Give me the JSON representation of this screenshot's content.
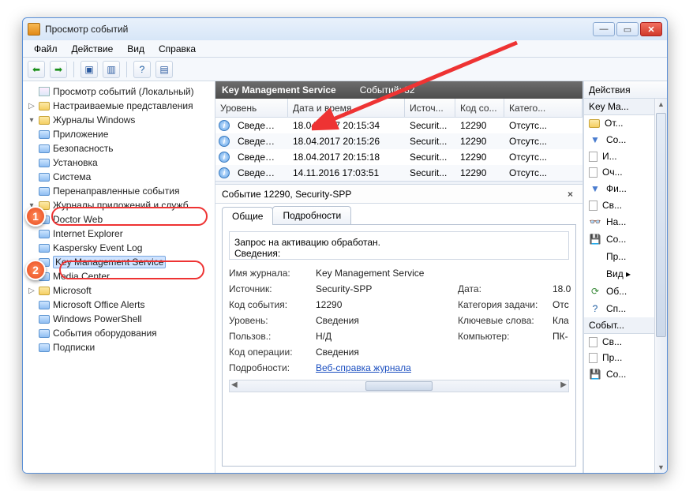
{
  "window": {
    "title": "Просмотр событий"
  },
  "menu": {
    "file": "Файл",
    "action": "Действие",
    "view": "Вид",
    "help": "Справка"
  },
  "tree": {
    "root": "Просмотр событий (Локальный)",
    "customViews": "Настраиваемые представления",
    "windowsLogs": "Журналы Windows",
    "app": "Приложение",
    "security": "Безопасность",
    "setup": "Установка",
    "system": "Система",
    "forwarded": "Перенаправленные события",
    "appServiceLogs": "Журналы приложений и служб",
    "drweb": "Doctor Web",
    "ie": "Internet Explorer",
    "kasp": "Kaspersky Event Log",
    "kms": "Key Management Service",
    "media": "Media Center",
    "microsoft": "Microsoft",
    "msoAlerts": "Microsoft Office Alerts",
    "powershell": "Windows PowerShell",
    "hardware": "События оборудования",
    "subs": "Подписки"
  },
  "mid": {
    "headerName": "Key Management Service",
    "headerCount": "Событий: 32",
    "cols": {
      "level": "Уровень",
      "datetime": "Дата и время",
      "source": "Источ...",
      "id": "Код со...",
      "cat": "Катего..."
    },
    "rows": [
      {
        "level": "Сведения",
        "dt": "18.04.2017 20:15:34",
        "src": "Securit...",
        "id": "12290",
        "cat": "Отсутс..."
      },
      {
        "level": "Сведения",
        "dt": "18.04.2017 20:15:26",
        "src": "Securit...",
        "id": "12290",
        "cat": "Отсутс..."
      },
      {
        "level": "Сведения",
        "dt": "18.04.2017 20:15:18",
        "src": "Securit...",
        "id": "12290",
        "cat": "Отсутс..."
      },
      {
        "level": "Сведения",
        "dt": "14.11.2016 17:03:51",
        "src": "Securit...",
        "id": "12290",
        "cat": "Отсутс..."
      }
    ],
    "detailTitle": "Событие 12290, Security-SPP",
    "tabs": {
      "general": "Общие",
      "details": "Подробности"
    },
    "message1": "Запрос на активацию обработан.",
    "message2": "Сведения:",
    "kv": {
      "logName_k": "Имя журнала:",
      "logName_v": "Key Management Service",
      "source_k": "Источник:",
      "source_v": "Security-SPP",
      "date_k": "Дата:",
      "date_v": "18.0",
      "eventId_k": "Код события:",
      "eventId_v": "12290",
      "taskCat_k": "Категория задачи:",
      "taskCat_v": "Отс",
      "level_k": "Уровень:",
      "level_v": "Сведения",
      "keywords_k": "Ключевые слова:",
      "keywords_v": "Кла",
      "user_k": "Пользов.:",
      "user_v": "Н/Д",
      "computer_k": "Компьютер:",
      "computer_v": "ПК-",
      "opcode_k": "Код операции:",
      "opcode_v": "Сведения",
      "more_k": "Подробности:",
      "more_link": "Веб-справка журнала"
    }
  },
  "actions": {
    "title": "Действия",
    "group1": "Key Ma...",
    "items1": [
      {
        "ico": "folder",
        "t": "От..."
      },
      {
        "ico": "funnel",
        "t": "Со..."
      },
      {
        "ico": "page",
        "t": "И..."
      },
      {
        "ico": "page",
        "t": "Оч..."
      },
      {
        "ico": "funnel",
        "t": "Фи..."
      },
      {
        "ico": "page",
        "t": "Св..."
      },
      {
        "ico": "bino",
        "t": "На..."
      },
      {
        "ico": "save",
        "t": "Со..."
      },
      {
        "ico": "",
        "t": "Пр..."
      },
      {
        "ico": "",
        "t": "Вид     ▸"
      },
      {
        "ico": "gear",
        "t": "Об..."
      },
      {
        "ico": "q",
        "t": "Сп..."
      }
    ],
    "group2": "Событ...",
    "items2": [
      {
        "ico": "page",
        "t": "Св..."
      },
      {
        "ico": "page",
        "t": "Пр..."
      },
      {
        "ico": "save",
        "t": "Со..."
      }
    ]
  }
}
